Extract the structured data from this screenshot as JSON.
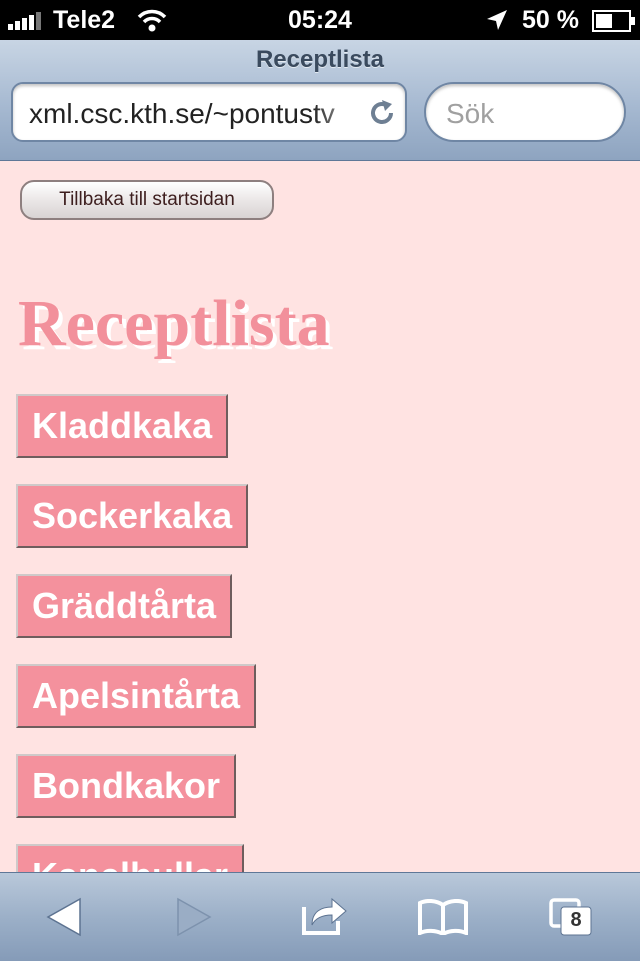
{
  "status_bar": {
    "carrier": "Tele2",
    "time": "05:24",
    "battery_percent": "50 %"
  },
  "browser": {
    "page_title": "Receptlista",
    "url": "xml.csc.kth.se/~pontustv",
    "search_placeholder": "Sök",
    "tab_count": "8"
  },
  "page": {
    "back_button_label": "Tillbaka till startsidan",
    "heading": "Receptlista",
    "recipes": [
      "Kladdkaka",
      "Sockerkaka",
      "Gräddtårta",
      "Apelsintårta",
      "Bondkakor",
      "Kanelbullar"
    ]
  },
  "colors": {
    "page_background": "#ffe3e2",
    "recipe_button": "#f4919d",
    "heading": "#f2909b"
  },
  "icons": {
    "status": [
      "signal-bars-icon",
      "wifi-icon",
      "location-arrow-icon",
      "battery-icon"
    ],
    "browser": [
      "reload-icon"
    ],
    "toolbar": [
      "back-arrow-icon",
      "forward-arrow-icon",
      "share-icon",
      "bookmarks-icon",
      "tabs-icon"
    ]
  }
}
